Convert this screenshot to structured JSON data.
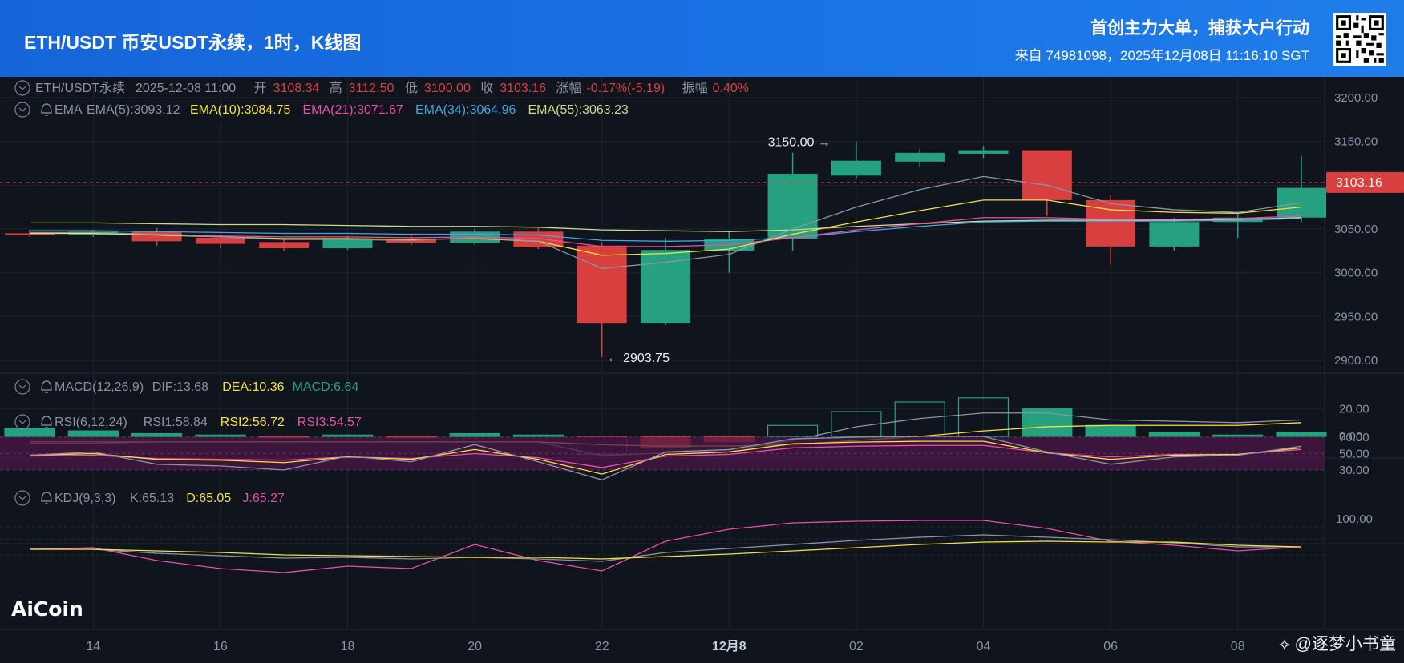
{
  "header": {
    "title": "ETH/USDT 币安USDT永续，1时，K线图",
    "slogan": "首创主力大单，捕获大户行动",
    "source": "来自 74981098，2025年12月08日 11:16:10 SGT"
  },
  "watermarks": {
    "brand": "AiCoin",
    "author": "@逐梦小书童"
  },
  "colors": {
    "up": "#26a17f",
    "down": "#d84040",
    "ema5": "#8b93a8",
    "ema10": "#f5e03a",
    "ema21": "#e84fa9",
    "ema34": "#3fa7e0",
    "ema55": "#c8dc8a",
    "rsi_band": "#4a1646"
  },
  "info_line": {
    "symbol": "ETH/USDT永续",
    "time": "2025-12-08 11:00",
    "open_label": "开",
    "open": "3108.34",
    "high_label": "高",
    "high": "3112.50",
    "low_label": "低",
    "low": "3100.00",
    "close_label": "收",
    "close": "3103.16",
    "change_label": "涨幅",
    "change": "-0.17%(-5.19)",
    "amp_label": "振幅",
    "amp": "0.40%"
  },
  "ema_legend": {
    "name": "EMA",
    "ema5": "EMA(5):3093.12",
    "ema10": "EMA(10):3084.75",
    "ema21": "EMA(21):3071.67",
    "ema34": "EMA(34):3064.96",
    "ema55": "EMA(55):3063.23"
  },
  "macd_legend": {
    "name": "MACD(12,26,9)",
    "dif": "DIF:13.68",
    "dea": "DEA:10.36",
    "macd": "MACD:6.64"
  },
  "rsi_legend": {
    "name": "RSI(6,12,24)",
    "rsi1": "RSI1:58.84",
    "rsi2": "RSI2:56.72",
    "rsi3": "RSI3:54.57"
  },
  "kdj_legend": {
    "name": "KDJ(9,3,3)",
    "k": "K:65.13",
    "d": "D:65.05",
    "j": "J:65.27"
  },
  "chart_data": {
    "type": "candlestick",
    "x_labels": [
      "14",
      "16",
      "18",
      "20",
      "22",
      "12月8",
      "02",
      "04",
      "06",
      "08"
    ],
    "price_axis": {
      "ticks": [
        "3200.00",
        "3150.00",
        "3100.00",
        "3050.00",
        "3000.00",
        "2950.00",
        "2900.00"
      ],
      "ylim": [
        2890,
        3210
      ]
    },
    "last_price": "3103.16",
    "high_marker": "3150.00",
    "low_marker": "2903.75",
    "candles": [
      {
        "o": 3045,
        "h": 3049,
        "l": 3041,
        "c": 3043
      },
      {
        "o": 3043,
        "h": 3049,
        "l": 3041,
        "c": 3047
      },
      {
        "o": 3047,
        "h": 3051,
        "l": 3031,
        "c": 3036
      },
      {
        "o": 3040,
        "h": 3044,
        "l": 3028,
        "c": 3033
      },
      {
        "o": 3035,
        "h": 3039,
        "l": 3025,
        "c": 3028
      },
      {
        "o": 3028,
        "h": 3042,
        "l": 3026,
        "c": 3038
      },
      {
        "o": 3039,
        "h": 3043,
        "l": 3031,
        "c": 3034
      },
      {
        "o": 3034,
        "h": 3050,
        "l": 3032,
        "c": 3047
      },
      {
        "o": 3047,
        "h": 3051,
        "l": 3027,
        "c": 3029
      },
      {
        "o": 3031,
        "h": 3035,
        "l": 2903.75,
        "c": 2942
      },
      {
        "o": 2942,
        "h": 3040,
        "l": 2940,
        "c": 3026
      },
      {
        "o": 3025,
        "h": 3047,
        "l": 3000,
        "c": 3039
      },
      {
        "o": 3039,
        "h": 3137,
        "l": 3025,
        "c": 3113
      },
      {
        "o": 3111,
        "h": 3150,
        "l": 3108,
        "c": 3128
      },
      {
        "o": 3127,
        "h": 3142,
        "l": 3121,
        "c": 3137
      },
      {
        "o": 3136,
        "h": 3145,
        "l": 3131,
        "c": 3140
      },
      {
        "o": 3140,
        "h": 3140,
        "l": 3065,
        "c": 3083
      },
      {
        "o": 3083,
        "h": 3089,
        "l": 3009,
        "c": 3030
      },
      {
        "o": 3030,
        "h": 3063,
        "l": 3025,
        "c": 3058
      },
      {
        "o": 3058,
        "h": 3067,
        "l": 3040,
        "c": 3063
      },
      {
        "o": 3063,
        "h": 3133,
        "l": 3058,
        "c": 3097
      }
    ],
    "ema": {
      "ema5": [
        3046,
        3046,
        3044,
        3041,
        3038,
        3038,
        3037,
        3040,
        3036,
        3005,
        3012,
        3021,
        3050,
        3075,
        3095,
        3110,
        3100,
        3079,
        3072,
        3069,
        3080
      ],
      "ema10": [
        3045,
        3045,
        3043,
        3041,
        3039,
        3039,
        3038,
        3039,
        3036,
        3020,
        3022,
        3027,
        3044,
        3058,
        3071,
        3083,
        3083,
        3072,
        3069,
        3068,
        3075
      ],
      "ema21": [
        3045,
        3045,
        3044,
        3042,
        3041,
        3041,
        3040,
        3041,
        3039,
        3030,
        3030,
        3032,
        3040,
        3049,
        3056,
        3063,
        3063,
        3061,
        3061,
        3062,
        3065
      ],
      "ema34": [
        3048,
        3048,
        3047,
        3046,
        3045,
        3045,
        3044,
        3044,
        3043,
        3037,
        3036,
        3037,
        3040,
        3047,
        3053,
        3058,
        3059,
        3059,
        3059,
        3060,
        3062
      ],
      "ema55": [
        3057,
        3057,
        3056,
        3055,
        3055,
        3054,
        3053,
        3053,
        3052,
        3049,
        3048,
        3047,
        3049,
        3053,
        3056,
        3059,
        3060,
        3060,
        3060,
        3061,
        3063
      ]
    },
    "macd": {
      "ticks": [
        "20.00",
        "0.00"
      ],
      "hist": [
        6,
        4,
        2,
        1,
        -1,
        1,
        -1,
        2,
        1,
        -13,
        -8,
        -4,
        8,
        18,
        25,
        28,
        20,
        8,
        3,
        1,
        3
      ],
      "dif": [
        -5,
        -5,
        -4,
        -4,
        -4,
        -4,
        -4,
        -4,
        -4,
        -14,
        -12,
        -10,
        -3,
        7,
        13,
        17,
        17,
        12,
        11,
        10,
        12
      ],
      "dea": [
        -4,
        -4,
        -4,
        -4,
        -4,
        -4,
        -4,
        -4,
        -4,
        -6,
        -7,
        -7,
        -6,
        -3,
        0,
        4,
        7,
        8,
        8,
        8,
        10
      ]
    },
    "rsi": {
      "ticks": [
        "70.00",
        "50.00",
        "30.00"
      ],
      "band": [
        30,
        70
      ],
      "rsi1": [
        48,
        52,
        37,
        35,
        30,
        47,
        40,
        61,
        40,
        18,
        52,
        55,
        68,
        70,
        71,
        71,
        52,
        37,
        46,
        48,
        59
      ],
      "rsi2": [
        48,
        50,
        43,
        42,
        39,
        46,
        43,
        55,
        43,
        25,
        49,
        52,
        62,
        64,
        65,
        65,
        51,
        43,
        48,
        49,
        57
      ],
      "rsi3": [
        47,
        48,
        44,
        43,
        42,
        46,
        44,
        50,
        45,
        33,
        47,
        49,
        57,
        59,
        60,
        60,
        51,
        46,
        49,
        49,
        55
      ]
    },
    "kdj": {
      "ticks": [
        "100.00"
      ],
      "k": [
        62,
        62,
        57,
        54,
        51,
        52,
        50,
        52,
        50,
        47,
        58,
        63,
        68,
        73,
        77,
        80,
        77,
        74,
        70,
        65,
        65
      ],
      "d": [
        62,
        62,
        60,
        58,
        55,
        54,
        53,
        52,
        52,
        50,
        53,
        56,
        60,
        64,
        68,
        71,
        72,
        71,
        71,
        67,
        65
      ],
      "j": [
        62,
        64,
        48,
        38,
        33,
        41,
        38,
        68,
        48,
        35,
        72,
        87,
        95,
        97,
        98,
        98,
        88,
        72,
        67,
        60,
        65
      ]
    }
  }
}
